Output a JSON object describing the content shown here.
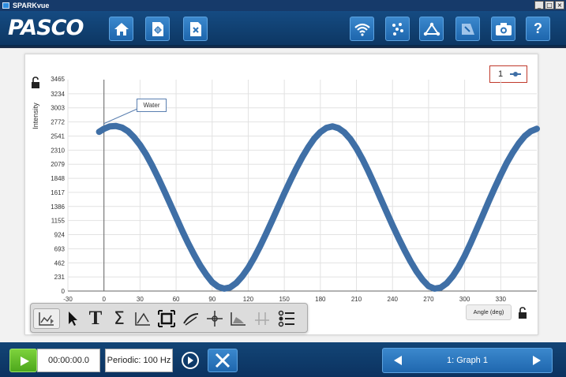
{
  "window": {
    "title": "SPARKvue",
    "controls": [
      "_",
      "□",
      "×"
    ]
  },
  "brand": {
    "logo": "PASCO"
  },
  "topbar": {
    "left_buttons": [
      "home-icon",
      "new-page-icon",
      "close-experiment-icon"
    ],
    "right_buttons": [
      "wireless-sensor-icon",
      "data-points-icon",
      "analysis-icon",
      "journal-icon",
      "snapshot-camera-icon",
      "help-icon"
    ],
    "help_label": "?"
  },
  "graph": {
    "legend_label": "1",
    "callout": "Water",
    "angle_button": "Angle (deg)"
  },
  "chart_data": {
    "type": "scatter",
    "title": "",
    "xlabel": "Angle (deg)",
    "ylabel": "Intensity",
    "xlim": [
      -30,
      360
    ],
    "ylim": [
      0,
      3465
    ],
    "x_ticks": [
      -30,
      0,
      30,
      60,
      90,
      120,
      150,
      180,
      210,
      240,
      270,
      300,
      330
    ],
    "y_ticks": [
      0,
      231,
      462,
      693,
      924,
      1155,
      1386,
      1617,
      1848,
      2079,
      2310,
      2541,
      2772,
      3003,
      3234
    ],
    "y_top_tick": "3465",
    "grid": true,
    "series": [
      {
        "name": "Water",
        "color": "#3f6fa6",
        "x": [
          -4,
          0,
          5,
          10,
          15,
          20,
          25,
          30,
          35,
          40,
          45,
          50,
          55,
          60,
          65,
          70,
          75,
          80,
          85,
          90,
          95,
          100,
          105,
          110,
          115,
          120,
          125,
          130,
          135,
          140,
          145,
          150,
          155,
          160,
          165,
          170,
          175,
          180,
          185,
          190,
          195,
          200,
          205,
          210,
          215,
          220,
          225,
          230,
          235,
          240,
          245,
          250,
          255,
          260,
          265,
          270,
          275,
          280,
          285,
          290,
          295,
          300,
          305,
          310,
          315,
          320,
          325,
          330,
          335,
          340,
          345,
          350,
          355,
          360
        ],
        "y": [
          2610,
          2660,
          2700,
          2705,
          2680,
          2620,
          2520,
          2395,
          2240,
          2060,
          1860,
          1650,
          1430,
          1210,
          990,
          785,
          595,
          420,
          270,
          145,
          70,
          40,
          60,
          130,
          240,
          380,
          550,
          740,
          945,
          1160,
          1380,
          1600,
          1810,
          2010,
          2195,
          2360,
          2500,
          2605,
          2675,
          2700,
          2670,
          2600,
          2490,
          2340,
          2160,
          1960,
          1745,
          1520,
          1300,
          1080,
          870,
          670,
          485,
          320,
          185,
          80,
          40,
          55,
          125,
          240,
          390,
          575,
          785,
          1010,
          1240,
          1470,
          1690,
          1900,
          2100,
          2270,
          2420,
          2540,
          2620,
          2660
        ]
      }
    ]
  },
  "toolbar": {
    "tools": [
      "graph-tools-icon",
      "select-pointer-icon",
      "text-annotation-icon",
      "statistics-sigma-icon",
      "curve-fit-icon",
      "zoom-fit-icon",
      "slope-tool-icon",
      "coordinates-tool-icon",
      "area-tool-icon",
      "delta-tool-icon",
      "legend-list-icon"
    ],
    "text_tool_glyph": "T",
    "sigma_glyph": "Σ"
  },
  "bottombar": {
    "timer": "00:00:00.0",
    "sample_rate": "Periodic: 100 Hz",
    "page_label": "1: Graph 1"
  }
}
